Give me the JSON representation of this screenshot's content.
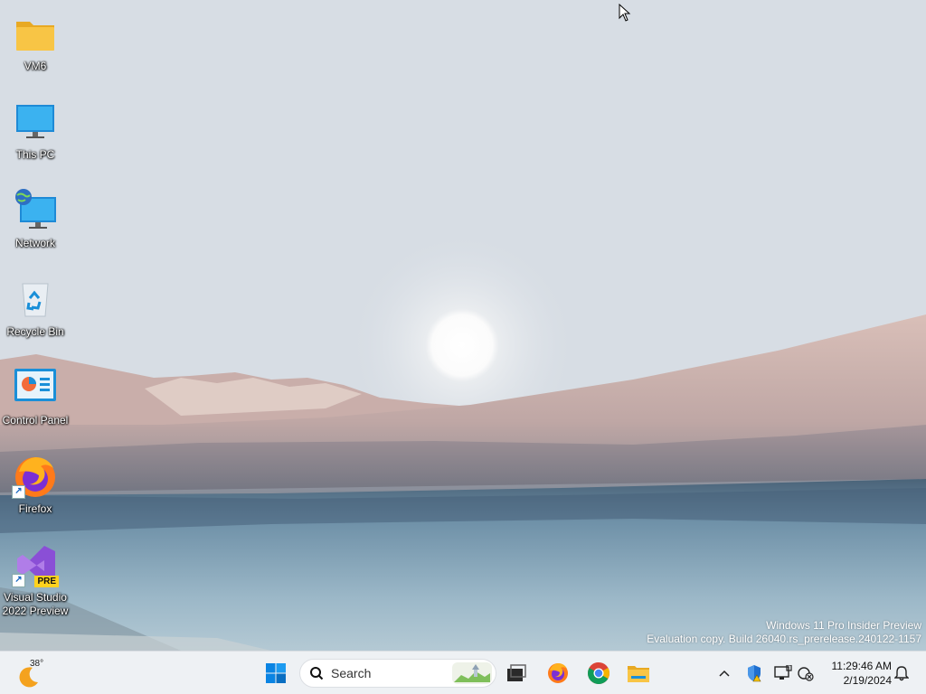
{
  "desktop_icons": [
    {
      "label": "VM6",
      "icon": "folder-icon"
    },
    {
      "label": "This PC",
      "icon": "monitor-icon"
    },
    {
      "label": "Network",
      "icon": "network-icon"
    },
    {
      "label": "Recycle Bin",
      "icon": "recycle-bin-icon"
    },
    {
      "label": "Control Panel",
      "icon": "control-panel-icon"
    },
    {
      "label": "Firefox",
      "icon": "firefox-icon"
    },
    {
      "label": "Visual Studio\n2022 Preview",
      "icon": "visual-studio-icon",
      "badge": "PRE"
    }
  ],
  "watermark": {
    "line1": "Windows 11 Pro Insider Preview",
    "line2": "Evaluation copy. Build 26040.rs_prerelease.240122-1157"
  },
  "taskbar": {
    "weather_temp": "38°",
    "search_placeholder": "Search",
    "pinned": [
      "start-icon",
      "task-view-icon",
      "firefox-icon",
      "chrome-icon",
      "file-explorer-icon"
    ],
    "tray_icons": [
      "chevron-up-icon",
      "defender-shield-icon",
      "display-icon",
      "network-disconnected-icon"
    ],
    "clock_time": "11:29:46 AM",
    "clock_date": "2/19/2024",
    "notification_icon": "bell-icon"
  },
  "colors": {
    "taskbar_bg": "#eef1f4",
    "windows_blue": "#0078d4",
    "folder_yellow": "#f8c545"
  }
}
